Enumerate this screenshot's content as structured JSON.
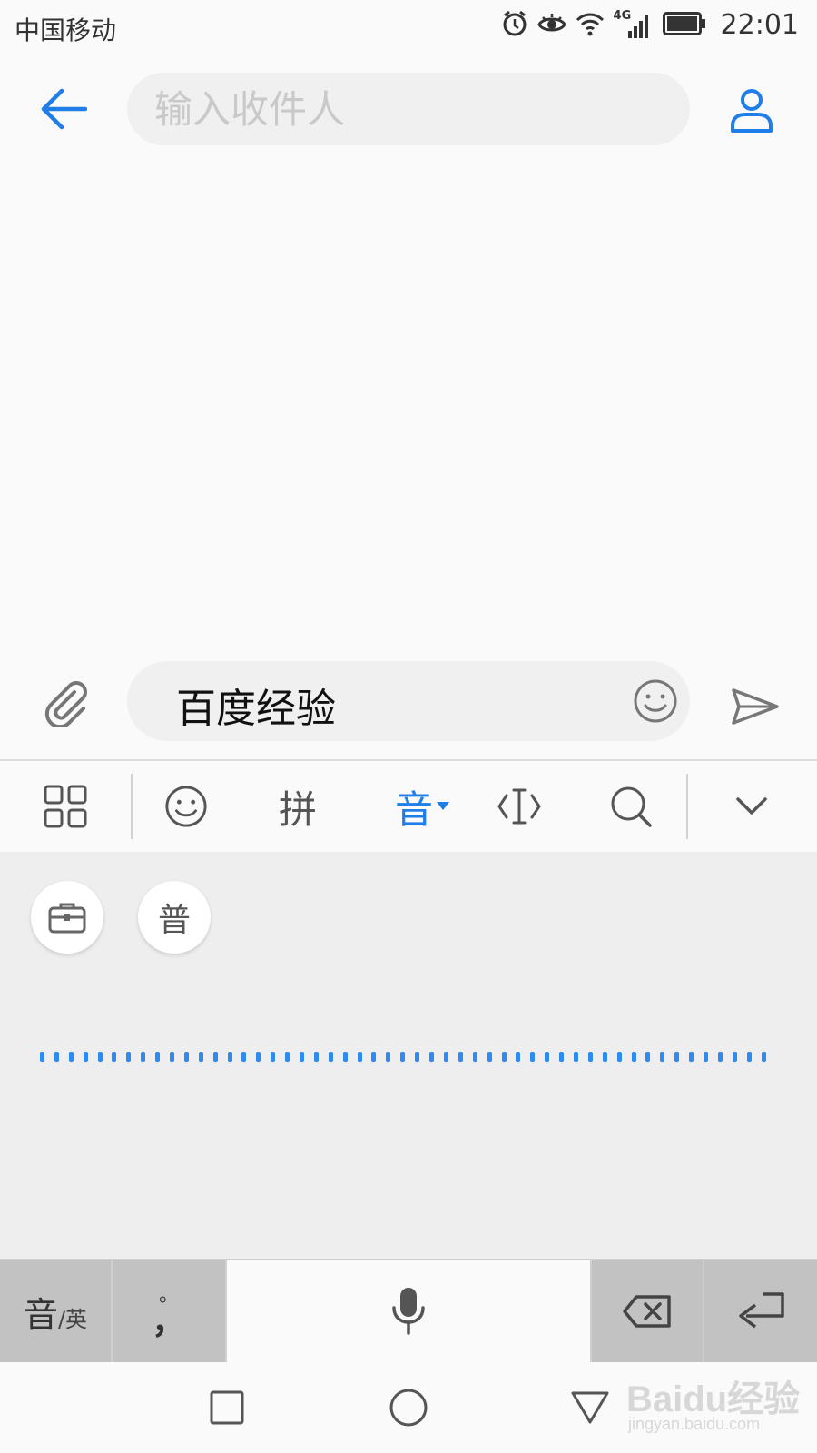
{
  "status_bar": {
    "carrier": "中国移动",
    "network": "4G",
    "time": "22:01",
    "icons": [
      "alarm-icon",
      "eye-icon",
      "wifi-icon",
      "signal-icon",
      "battery-icon"
    ]
  },
  "header": {
    "recipient_placeholder": "输入收件人",
    "icons": [
      "back-arrow-icon",
      "contact-icon"
    ]
  },
  "compose": {
    "message_text": "百度经验",
    "icons": [
      "paperclip-icon",
      "smiley-icon",
      "send-icon"
    ]
  },
  "ime_toolbar": {
    "pinyin_label": "拼",
    "voice_label": "音",
    "icons": [
      "grid-icon",
      "emoji-icon",
      "cursor-icon",
      "search-icon",
      "collapse-icon"
    ]
  },
  "ime_panel": {
    "mandarin_label": "普",
    "icons": [
      "toolbox-icon",
      "voice-wave"
    ]
  },
  "keyboard": {
    "lang_key_main": "音",
    "lang_key_sub": "/英",
    "punct_top": "。",
    "punct_bottom": "，",
    "icons": [
      "microphone-icon",
      "backspace-icon",
      "enter-icon"
    ]
  },
  "nav_bar": {
    "icons": [
      "recent-apps-icon",
      "home-icon",
      "back-icon"
    ]
  },
  "watermark": {
    "logo": "Baidu经验",
    "url": "jingyan.baidu.com"
  },
  "colors": {
    "accent": "#1f7ee8",
    "background": "#fafafa",
    "input_bg": "#f0f0f0",
    "ime_panel_bg": "#eeeeee",
    "key_gray": "#c2c2c2"
  }
}
